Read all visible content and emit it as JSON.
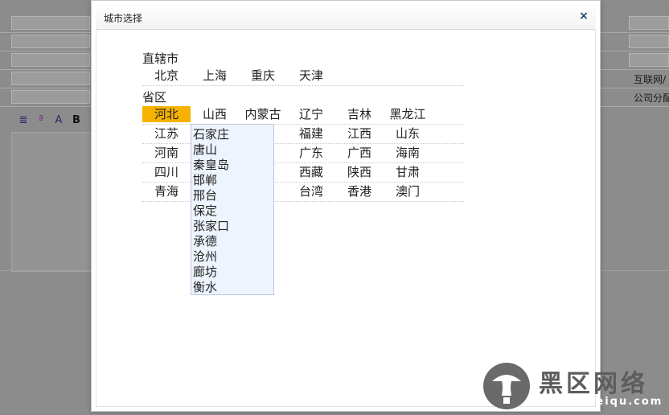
{
  "background": {
    "form_row_labels": [
      "互联网/",
      "公司分配"
    ],
    "toolbar_icons": [
      "line-spacing-icon",
      "spellcheck-icon",
      "font-size-icon",
      "bold-icon"
    ],
    "bold_label": "B"
  },
  "dialog": {
    "title": "城市选择",
    "close_label": "×"
  },
  "municipalities": {
    "title": "直辖市",
    "cities": [
      "北京",
      "上海",
      "重庆",
      "天津"
    ]
  },
  "provinces": {
    "title": "省区",
    "rows": [
      [
        "河北",
        "山西",
        "内蒙古",
        "辽宁",
        "吉林",
        "黑龙江"
      ],
      [
        "江苏",
        "",
        "",
        "福建",
        "江西",
        "山东"
      ],
      [
        "河南",
        "",
        "",
        "广东",
        "广西",
        "海南"
      ],
      [
        "四川",
        "",
        "",
        "西藏",
        "陕西",
        "甘肃"
      ],
      [
        "青海",
        "",
        "",
        "台湾",
        "香港",
        "澳门"
      ]
    ],
    "selected": "河北"
  },
  "dropdown": {
    "items": [
      "石家庄",
      "唐山",
      "秦皇岛",
      "邯郸",
      "邢台",
      "保定",
      "张家口",
      "承德",
      "沧州",
      "廊坊",
      "衡水"
    ]
  },
  "watermark": {
    "text": "黑区网络",
    "url": "www.heiqu.com"
  },
  "colors": {
    "selected": "#f5b200",
    "dropdown_bg": "#eef4fd",
    "overlay": "#8c8c8c"
  }
}
